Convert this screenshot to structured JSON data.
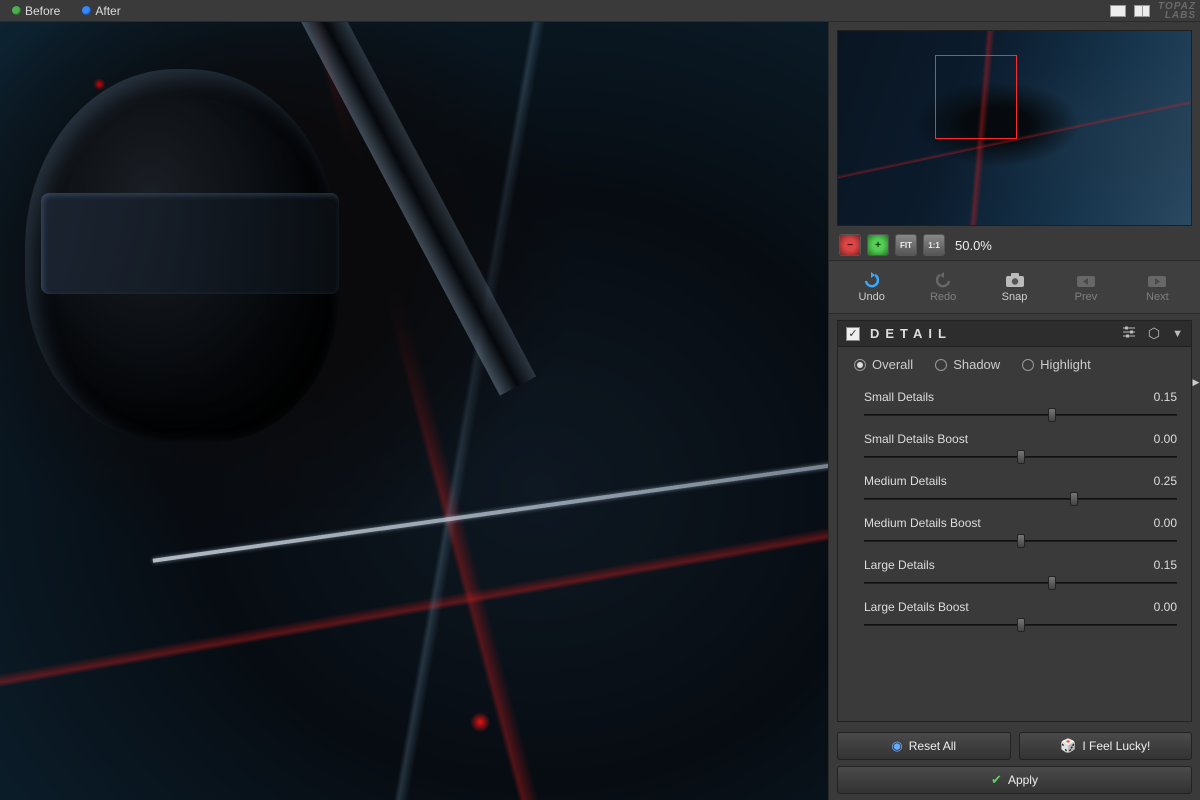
{
  "topbar": {
    "before_label": "Before",
    "after_label": "After",
    "logo_top": "TOPAZ",
    "logo_bottom": "LABS"
  },
  "navigator": {
    "zoom_minus": "−",
    "zoom_plus": "+",
    "zoom_fit": "FIT",
    "zoom_one": "1:1",
    "zoom_label": "50.0%"
  },
  "history": {
    "undo": "Undo",
    "redo": "Redo",
    "snap": "Snap",
    "prev": "Prev",
    "next": "Next"
  },
  "panel": {
    "title": "DETAIL",
    "radios": {
      "overall": "Overall",
      "shadow": "Shadow",
      "highlight": "Highlight"
    },
    "sliders": [
      {
        "label": "Small Details",
        "value": "0.15",
        "pos": 60
      },
      {
        "label": "Small Details Boost",
        "value": "0.00",
        "pos": 50
      },
      {
        "label": "Medium Details",
        "value": "0.25",
        "pos": 67
      },
      {
        "label": "Medium Details Boost",
        "value": "0.00",
        "pos": 50
      },
      {
        "label": "Large Details",
        "value": "0.15",
        "pos": 60
      },
      {
        "label": "Large Details Boost",
        "value": "0.00",
        "pos": 50
      }
    ]
  },
  "buttons": {
    "reset_all": "Reset All",
    "lucky": "I Feel Lucky!",
    "apply": "Apply"
  }
}
